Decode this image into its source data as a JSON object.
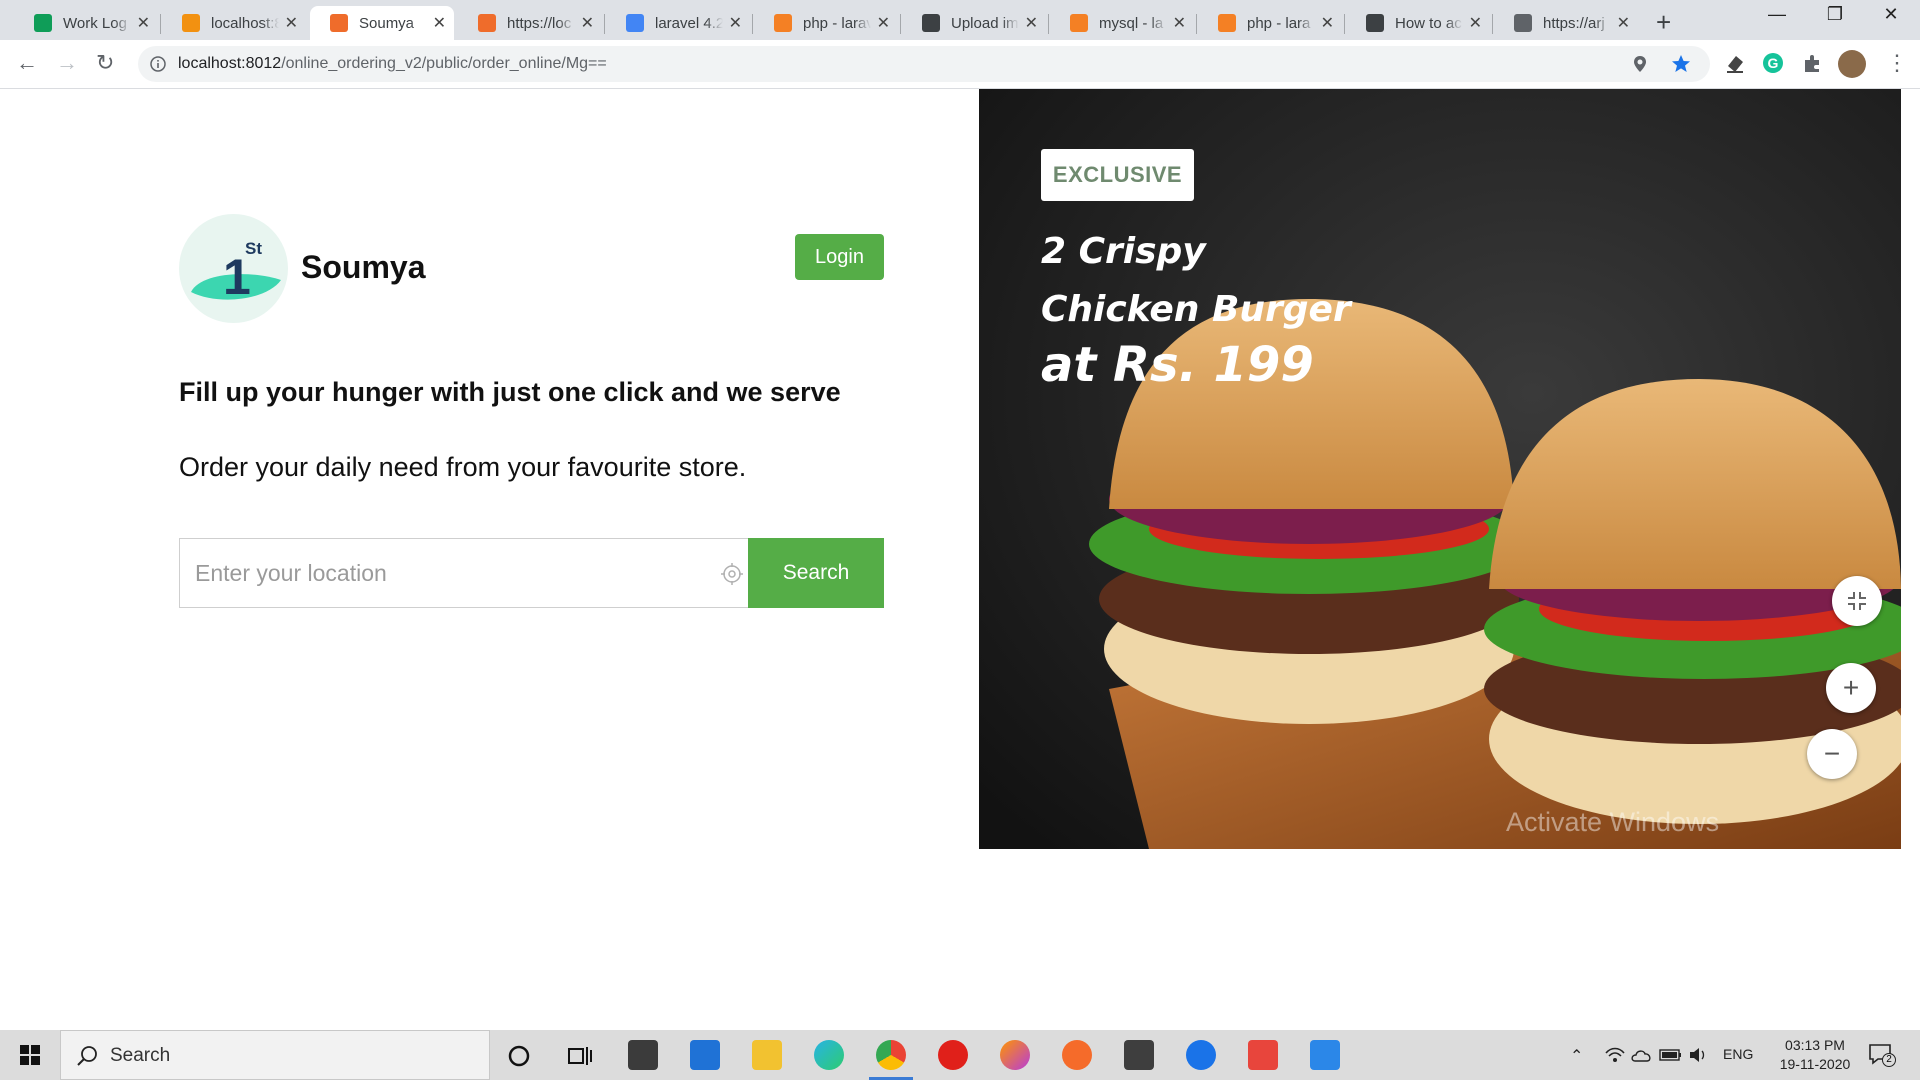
{
  "browser": {
    "tabs": [
      {
        "title": "Work Log",
        "icon": "sheets-icon",
        "color": "#0f9d58"
      },
      {
        "title": "localhost:8",
        "icon": "phpmyadmin-icon",
        "color": "#f29111"
      },
      {
        "title": "Soumya",
        "icon": "site-icon",
        "color": "#ef6c2b",
        "active": true
      },
      {
        "title": "https://loc",
        "icon": "site-icon",
        "color": "#ef6c2b"
      },
      {
        "title": "laravel 4.2",
        "icon": "google-icon",
        "color": "#4285f4"
      },
      {
        "title": "php - larav",
        "icon": "stackoverflow-icon",
        "color": "#f48024"
      },
      {
        "title": "Upload im",
        "icon": "send-icon",
        "color": "#3c4043"
      },
      {
        "title": "mysql - la",
        "icon": "stackoverflow-icon",
        "color": "#f48024"
      },
      {
        "title": "php - lara",
        "icon": "stackoverflow-icon",
        "color": "#f48024"
      },
      {
        "title": "How to ac",
        "icon": "send-icon",
        "color": "#3c4043"
      },
      {
        "title": "https://arj",
        "icon": "globe-icon",
        "color": "#5f6368"
      }
    ],
    "url_host": "localhost:8012",
    "url_path": "/online_ordering_v2/public/order_online/Mg=="
  },
  "page": {
    "brand_name": "Soumya",
    "logo_text": "1",
    "logo_sup": "St",
    "login_label": "Login",
    "headline": "Fill up your hunger with just one click and we serve",
    "subline": "Order your daily need from your favourite store.",
    "location_placeholder": "Enter your location",
    "search_label": "Search",
    "accent": "#55ad47"
  },
  "banner": {
    "badge": "EXCLUSIVE",
    "line1": "2 Crispy",
    "line2": "Chicken Burger",
    "line3": "at Rs. 199",
    "watermark": "Activate Windows"
  },
  "taskbar": {
    "search_label": "Search",
    "language": "ENG",
    "time": "03:13 PM",
    "date": "19-11-2020",
    "notifications": "2"
  }
}
